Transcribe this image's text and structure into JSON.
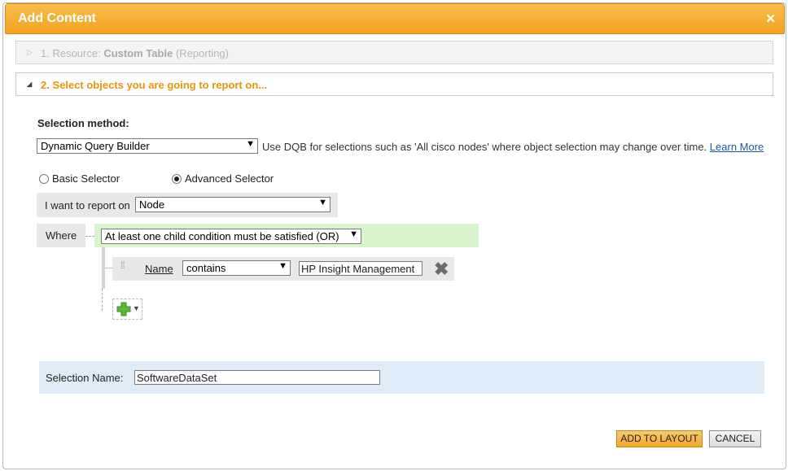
{
  "dialog": {
    "title": "Add Content",
    "close_icon": "close-icon"
  },
  "steps": {
    "step1": {
      "prefix": "1. Resource:",
      "resource": "Custom Table",
      "suffix": "(Reporting)"
    },
    "step2": {
      "label": "2. Select objects you are going to report on..."
    }
  },
  "selection": {
    "method_label": "Selection method:",
    "method_value": "Dynamic Query Builder",
    "method_help": "Use DQB for selections such as 'All cisco nodes' where object selection may change over time.",
    "learn_more": "Learn More",
    "radio_basic": "Basic Selector",
    "radio_advanced": "Advanced Selector",
    "selected_radio": "advanced"
  },
  "query": {
    "report_on_label": "I want to report on",
    "report_on_value": "Node",
    "where_label": "Where",
    "condition_value": "At least one child condition must be satisfied (OR)",
    "rule": {
      "field": "Name",
      "operator": "contains",
      "value": "HP Insight Management"
    }
  },
  "selection_name": {
    "label": "Selection Name:",
    "value": "SoftwareDataSet"
  },
  "buttons": {
    "add_to_layout": "ADD TO LAYOUT",
    "cancel": "CANCEL"
  },
  "colors": {
    "titlebar": "#f3a320",
    "step_active": "#e7950f",
    "condition_bg": "#d8f5cd",
    "name_panel_bg": "#e0edf8"
  }
}
